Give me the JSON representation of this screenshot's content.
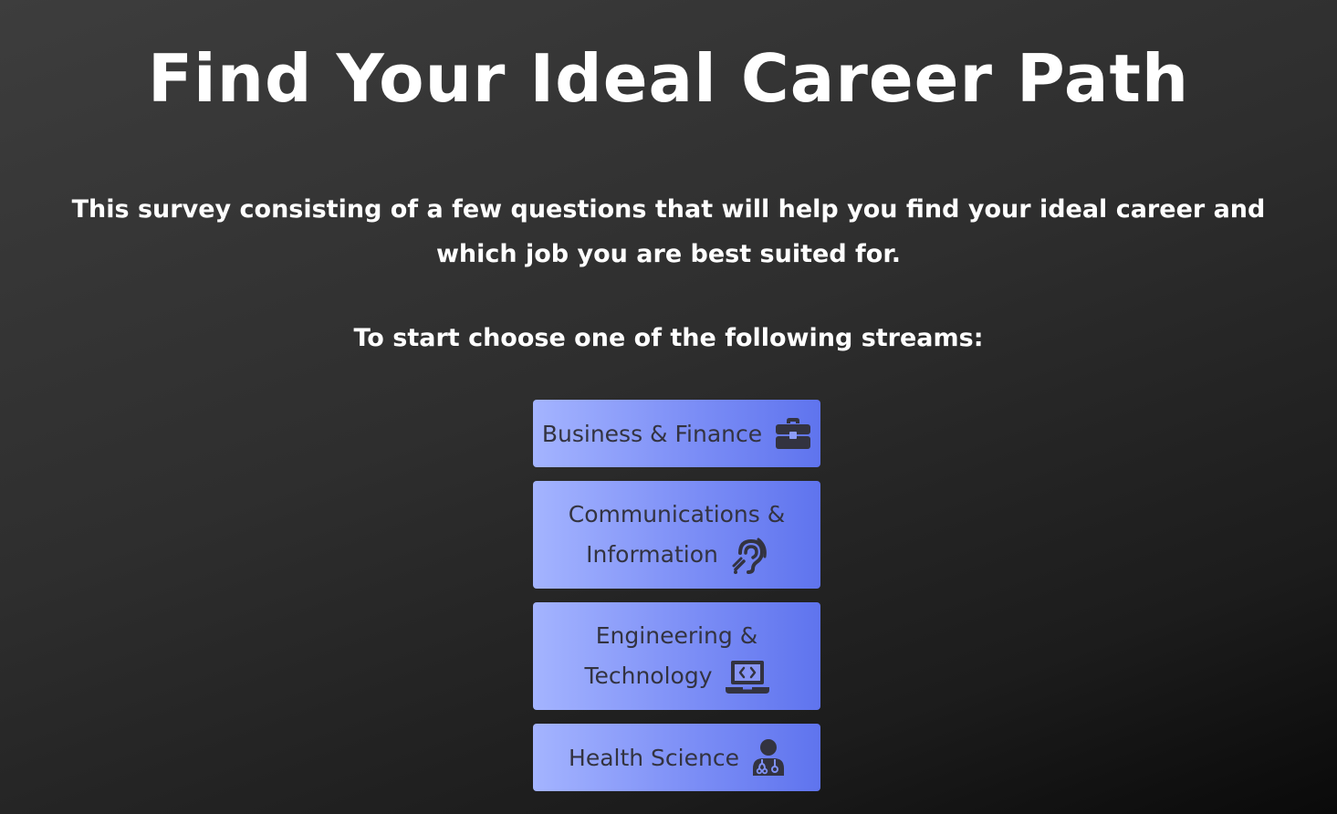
{
  "page": {
    "title": "Find Your Ideal Career Path",
    "intro": "This survey consisting of a few questions that will help you find your ideal career and which job you are best suited for.",
    "prompt": "To start choose one of the following streams:"
  },
  "streams": [
    {
      "line1": "Business & Finance",
      "icon": "briefcase-icon"
    },
    {
      "line1": "Communications &",
      "line2": "Information",
      "icon": "hearing-icon"
    },
    {
      "line1": "Engineering &",
      "line2": "Technology",
      "icon": "laptop-code-icon"
    },
    {
      "line1": "Health Science",
      "icon": "doctor-icon"
    }
  ],
  "colors": {
    "button_gradient_start": "#a4b4ff",
    "button_gradient_end": "#5f74ee",
    "button_text": "#333340",
    "background_dark": "#0a0a0a",
    "background_light": "#3d3d3d"
  }
}
